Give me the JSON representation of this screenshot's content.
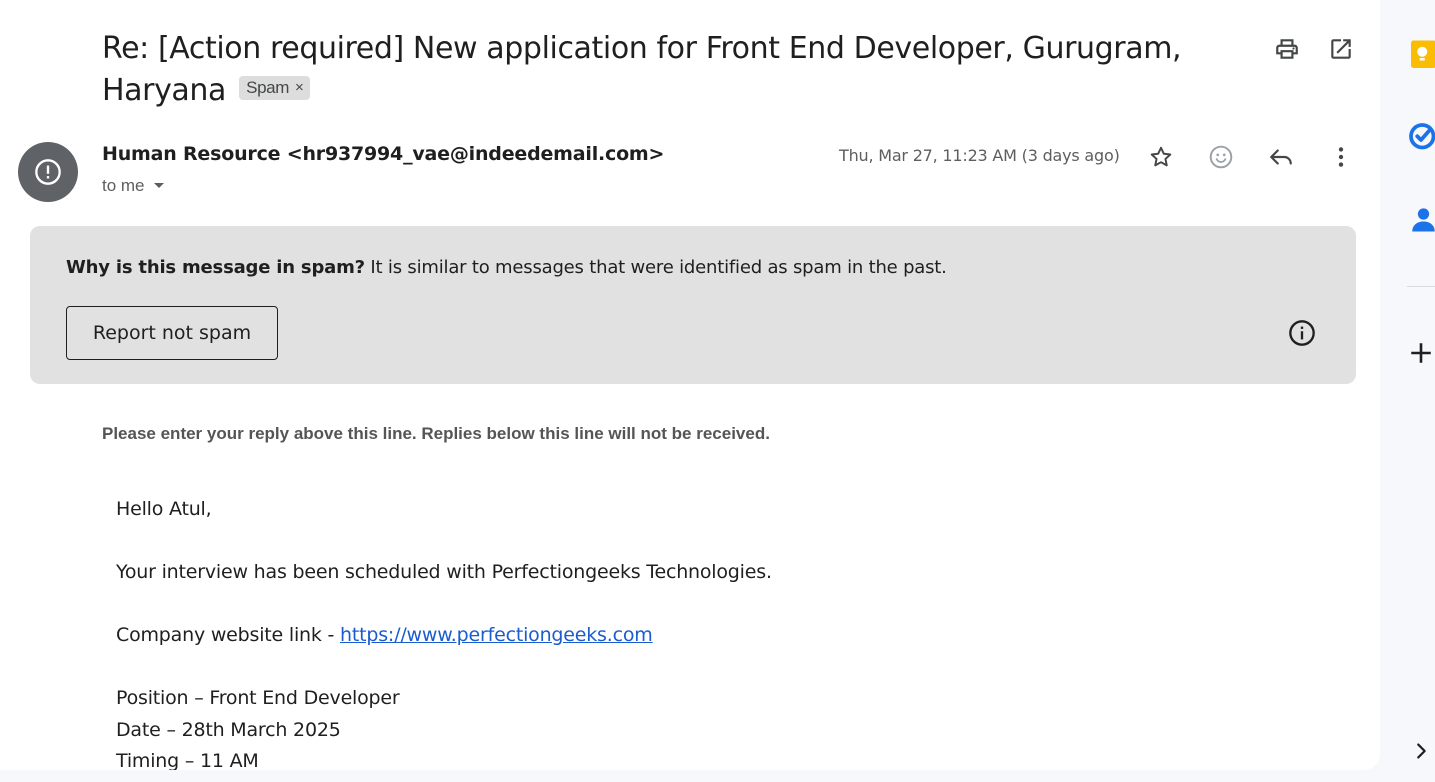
{
  "email": {
    "subject": "Re: [Action required] New application for Front End Developer, Gurugram, Haryana",
    "label_chip": "Spam",
    "label_chip_remove": "×",
    "sender": "Human Resource <hr937994_vae@indeedemail.com>",
    "recipient": "to me",
    "date": "Thu, Mar 27, 11:23 AM (3 days ago)"
  },
  "spam_notice": {
    "title": "Why is this message in spam?",
    "reason": " It is similar to messages that were identified as spam in the past.",
    "report_button": "Report not spam"
  },
  "body": {
    "reply_line": "Please enter your reply above this line. Replies below this line will not be received.",
    "greeting": "Hello Atul,",
    "paragraph1": "Your interview has been scheduled with Perfectiongeeks Technologies.",
    "website_prefix": "Company website link - ",
    "website_link": "https://www.perfectiongeeks.com",
    "position": "Position – Front End Developer",
    "date": "Date – 28th March 2025",
    "timing": "Timing – 11 AM"
  },
  "icons": {
    "print": "print-icon",
    "open_new_window": "open-in-new-window-icon",
    "avatar": "spam-warning-icon",
    "star": "star-icon",
    "emoji": "emoji-reaction-icon",
    "reply": "reply-icon",
    "more": "more-vertical-icon",
    "info": "info-icon",
    "keep": "keep-icon",
    "tasks": "tasks-icon",
    "contacts": "contacts-icon",
    "add": "add-icon",
    "expand": "chevron-right-icon"
  },
  "colors": {
    "link": "#1a5ccf",
    "spam_banner": "#e1e1e1",
    "keep_yellow": "#fbbc04",
    "tasks_blue": "#1a73e8",
    "contacts_blue": "#1a73e8"
  }
}
